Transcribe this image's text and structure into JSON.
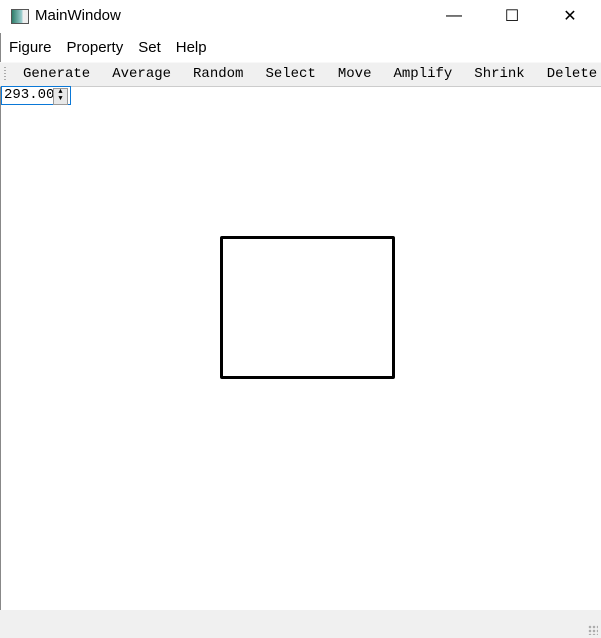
{
  "window": {
    "title": "MainWindow",
    "minimize": "—",
    "maximize": "☐",
    "close": "✕"
  },
  "menubar": [
    "Figure",
    "Property",
    "Set",
    "Help"
  ],
  "toolbar": [
    "Generate",
    "Average",
    "Random",
    "Select",
    "Move",
    "Amplify",
    "Shrink",
    "Delete"
  ],
  "spinbox": {
    "value": "293.00"
  }
}
